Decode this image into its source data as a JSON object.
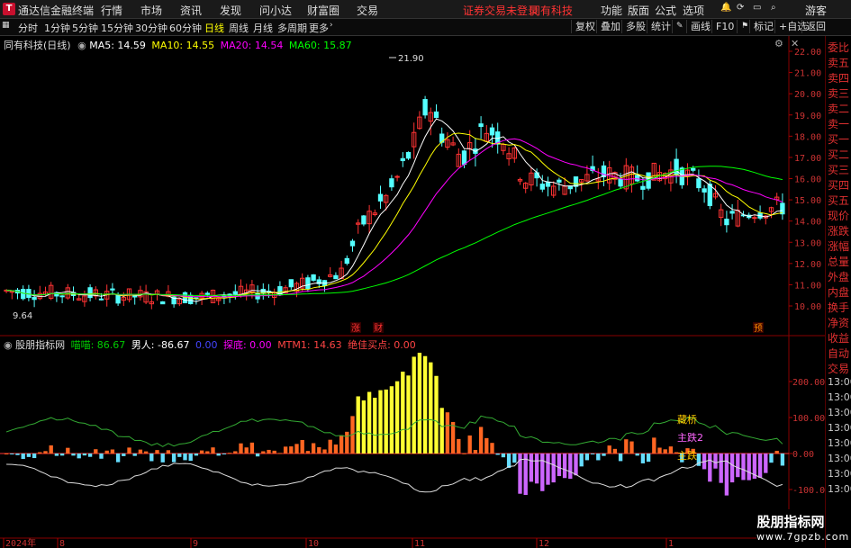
{
  "titlebar": {
    "app_title": "通达信金融终端",
    "menus": [
      "行情",
      "市场",
      "资讯",
      "发现",
      "问小达",
      "财富圈",
      "交易"
    ],
    "notice": "证券交易未登录",
    "stock": "同有科技",
    "right_menus": [
      "功能",
      "版面",
      "公式",
      "选项"
    ],
    "user": "游客"
  },
  "toolbar": {
    "periods": [
      "分时",
      "1分钟",
      "5分钟",
      "15分钟",
      "30分钟",
      "60分钟",
      "日线",
      "周线",
      "月线",
      "多周期",
      "更多"
    ],
    "active_period": "日线",
    "right_buttons": [
      "复权",
      "叠加",
      "多股",
      "统计",
      "画线",
      "F10",
      "标记",
      "+自选",
      "返回"
    ]
  },
  "main_chart": {
    "title": "同有科技(日线)",
    "ma_labels": [
      {
        "text": "MA5: 14.59",
        "color": "#ffffff"
      },
      {
        "text": "MA10: 14.55",
        "color": "#ffff00"
      },
      {
        "text": "MA20: 14.54",
        "color": "#ff00ff"
      },
      {
        "text": "MA60: 15.87",
        "color": "#00ff00"
      }
    ],
    "high_label": "21.90",
    "low_label": "9.64",
    "y_ticks": [
      "22.00",
      "21.00",
      "20.00",
      "19.00",
      "18.00",
      "17.00",
      "16.00",
      "15.00",
      "14.00",
      "13.00",
      "12.00",
      "11.00",
      "10.00"
    ],
    "markers": [
      "涨",
      "财",
      "预"
    ]
  },
  "indicator": {
    "name": "股朋指标网",
    "labels": [
      {
        "text": "喵喵: 86.67",
        "color": "#00cc00"
      },
      {
        "text": "男人: -86.67",
        "color": "#ffffff"
      },
      {
        "text": "0.00",
        "color": "#4444ff"
      },
      {
        "text": "探底: 0.00",
        "color": "#ff00ff"
      },
      {
        "text": "MTM1: 14.63",
        "color": "#ff4444"
      },
      {
        "text": "绝佳买点: 0.00",
        "color": "#ff4444"
      }
    ],
    "y_ticks": [
      "200.00",
      "100.00",
      "0.00",
      "-100.00"
    ],
    "signals": [
      "藏桥",
      "主跌2",
      "主跌"
    ]
  },
  "time_axis": [
    "2024年",
    "8",
    "9",
    "10",
    "11",
    "12",
    "1"
  ],
  "sidebar": [
    "委比",
    "卖五",
    "卖四",
    "卖三",
    "卖二",
    "卖一",
    "买一",
    "买二",
    "买三",
    "买四",
    "买五",
    "现价",
    "涨跌",
    "涨幅",
    "总量",
    "外盘",
    "内盘",
    "换手",
    "净资",
    "收益",
    "自动",
    "交易",
    "13:00",
    "13:00",
    "13:00",
    "13:00",
    "13:00",
    "13:00",
    "13:00",
    "13:00"
  ],
  "watermark": {
    "cn": "股朋指标网",
    "url": "www.7gpzb.com"
  },
  "colors": {
    "up": "#ff3333",
    "down": "#54ffff",
    "grid": "#550000",
    "text_red": "#e03030"
  }
}
